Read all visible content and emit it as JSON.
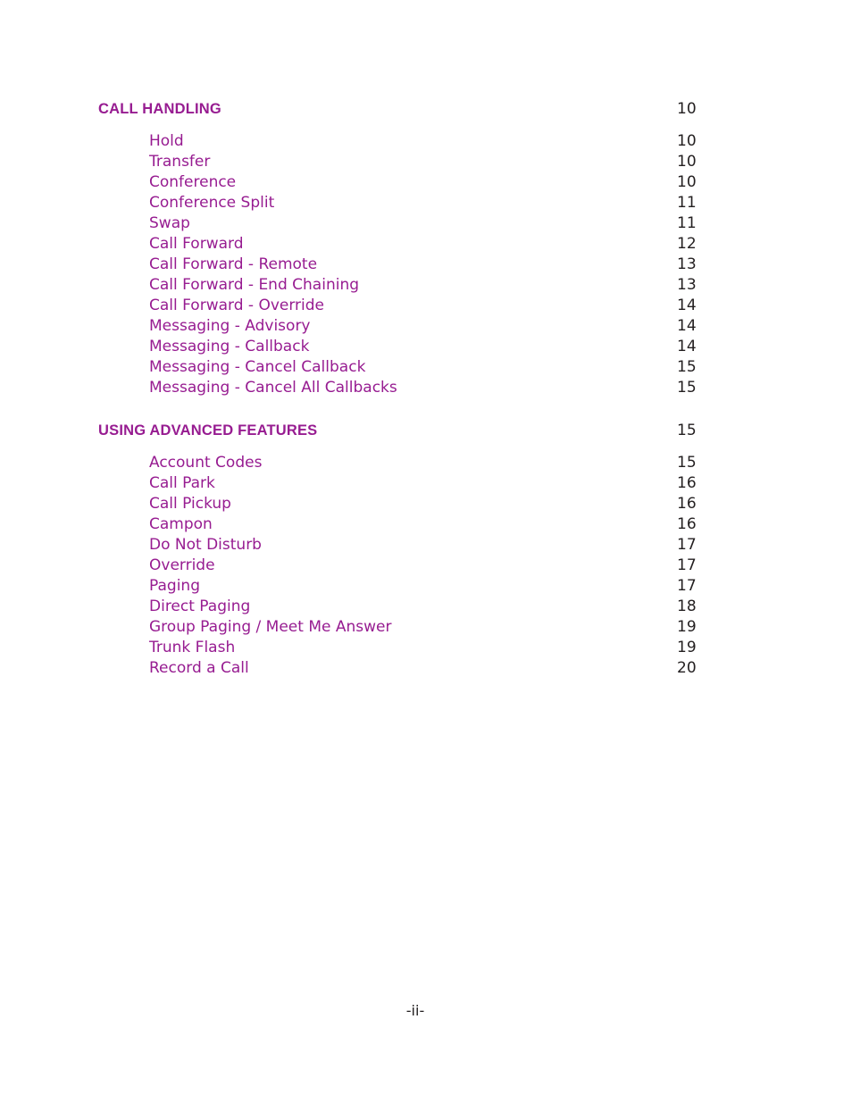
{
  "document": {
    "type": "table-of-contents",
    "footer_page_marker": "-ii-",
    "colors": {
      "heading_purple": "#971C91",
      "entry_purple": "#971C91",
      "page_number_black": "#231f20",
      "background": "#ffffff"
    }
  },
  "sections": [
    {
      "title": "CALL HANDLING",
      "page": "10",
      "entries": [
        {
          "label": "Hold",
          "page": "10"
        },
        {
          "label": "Transfer",
          "page": "10"
        },
        {
          "label": "Conference",
          "page": "10"
        },
        {
          "label": "Conference Split",
          "page": "11"
        },
        {
          "label": "Swap",
          "page": "11"
        },
        {
          "label": "Call Forward",
          "page": "12"
        },
        {
          "label": "Call Forward - Remote",
          "page": "13"
        },
        {
          "label": "Call Forward - End Chaining",
          "page": "13"
        },
        {
          "label": "Call Forward - Override",
          "page": "14"
        },
        {
          "label": "Messaging - Advisory",
          "page": "14"
        },
        {
          "label": "Messaging - Callback",
          "page": "14"
        },
        {
          "label": "Messaging - Cancel Callback",
          "page": "15"
        },
        {
          "label": "Messaging - Cancel All Callbacks",
          "page": "15"
        }
      ]
    },
    {
      "title": "USING ADVANCED FEATURES",
      "page": "15",
      "entries": [
        {
          "label": "Account Codes",
          "page": "15"
        },
        {
          "label": "Call Park",
          "page": "16"
        },
        {
          "label": "Call Pickup",
          "page": "16"
        },
        {
          "label": "Campon",
          "page": "16"
        },
        {
          "label": "Do Not Disturb",
          "page": "17"
        },
        {
          "label": "Override",
          "page": "17"
        },
        {
          "label": "Paging",
          "page": "17"
        },
        {
          "label": "Direct Paging",
          "page": "18"
        },
        {
          "label": "Group Paging / Meet Me Answer",
          "page": "19"
        },
        {
          "label": "Trunk Flash",
          "page": "19"
        },
        {
          "label": "Record a Call",
          "page": "20"
        }
      ]
    }
  ]
}
